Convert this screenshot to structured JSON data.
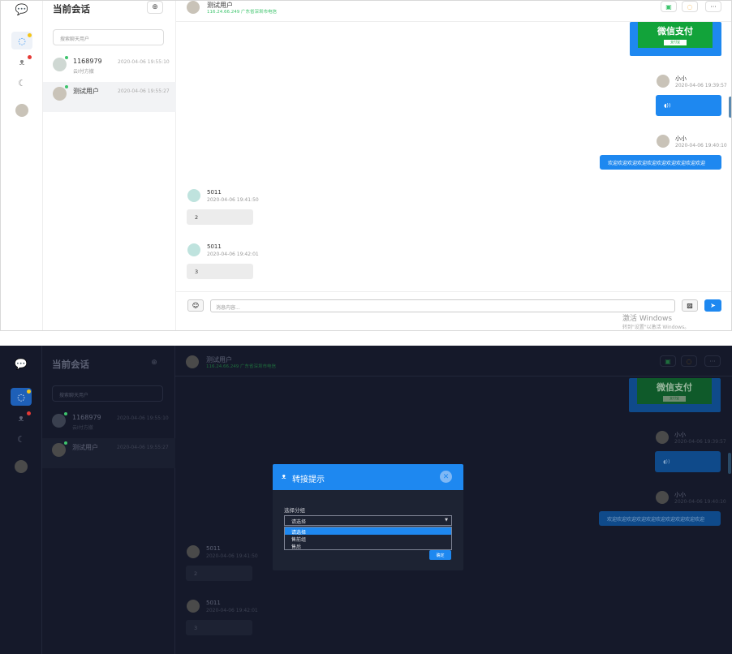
{
  "sidebar": {
    "logo": "logo-chat",
    "chat_badge_color": "#f5c518",
    "contacts_badge_color": "#e53935"
  },
  "sessions": {
    "title": "当前会话",
    "search_placeholder": "搜索聊天用户",
    "items": [
      {
        "name": "1168979",
        "preview": "云I付方撤",
        "time": "2020-04-06 19:55:10"
      },
      {
        "name": "测试用户",
        "preview": "",
        "time": "2020-04-06 19:55:27"
      }
    ]
  },
  "chat": {
    "user_name": "测试用户",
    "user_ip": "116.24.66.249 广东省深圳市电信",
    "pay_title": "微信支付",
    "pay_sub": "支付宝",
    "messages": [
      {
        "side": "right",
        "name": "小小",
        "time": "2020-04-06 19:39:57",
        "text": ""
      },
      {
        "side": "right",
        "name": "小小",
        "time": "2020-04-06 19:40:10",
        "text": "欢迎欢迎欢迎欢迎欢迎欢迎欢迎欢迎欢迎欢迎"
      },
      {
        "side": "left",
        "name": "5011",
        "time": "2020-04-06 19:41:50",
        "text": "2"
      },
      {
        "side": "left",
        "name": "5011",
        "time": "2020-04-06 19:42:01",
        "text": "3"
      }
    ],
    "input_placeholder": "消息内容..."
  },
  "watermark": {
    "line1": "激活 Windows",
    "line2": "转到\"设置\"以激活 Windows。"
  },
  "modal": {
    "title": "转接提示",
    "label": "选择分组",
    "selected": "请选择",
    "options": [
      "请选择",
      "售前组",
      "售后"
    ],
    "confirm": "确定"
  },
  "colors": {
    "accent": "#1e88f0",
    "online": "#3ec46d",
    "pay_green": "#12a33a",
    "dark_bg": "#15192a"
  }
}
